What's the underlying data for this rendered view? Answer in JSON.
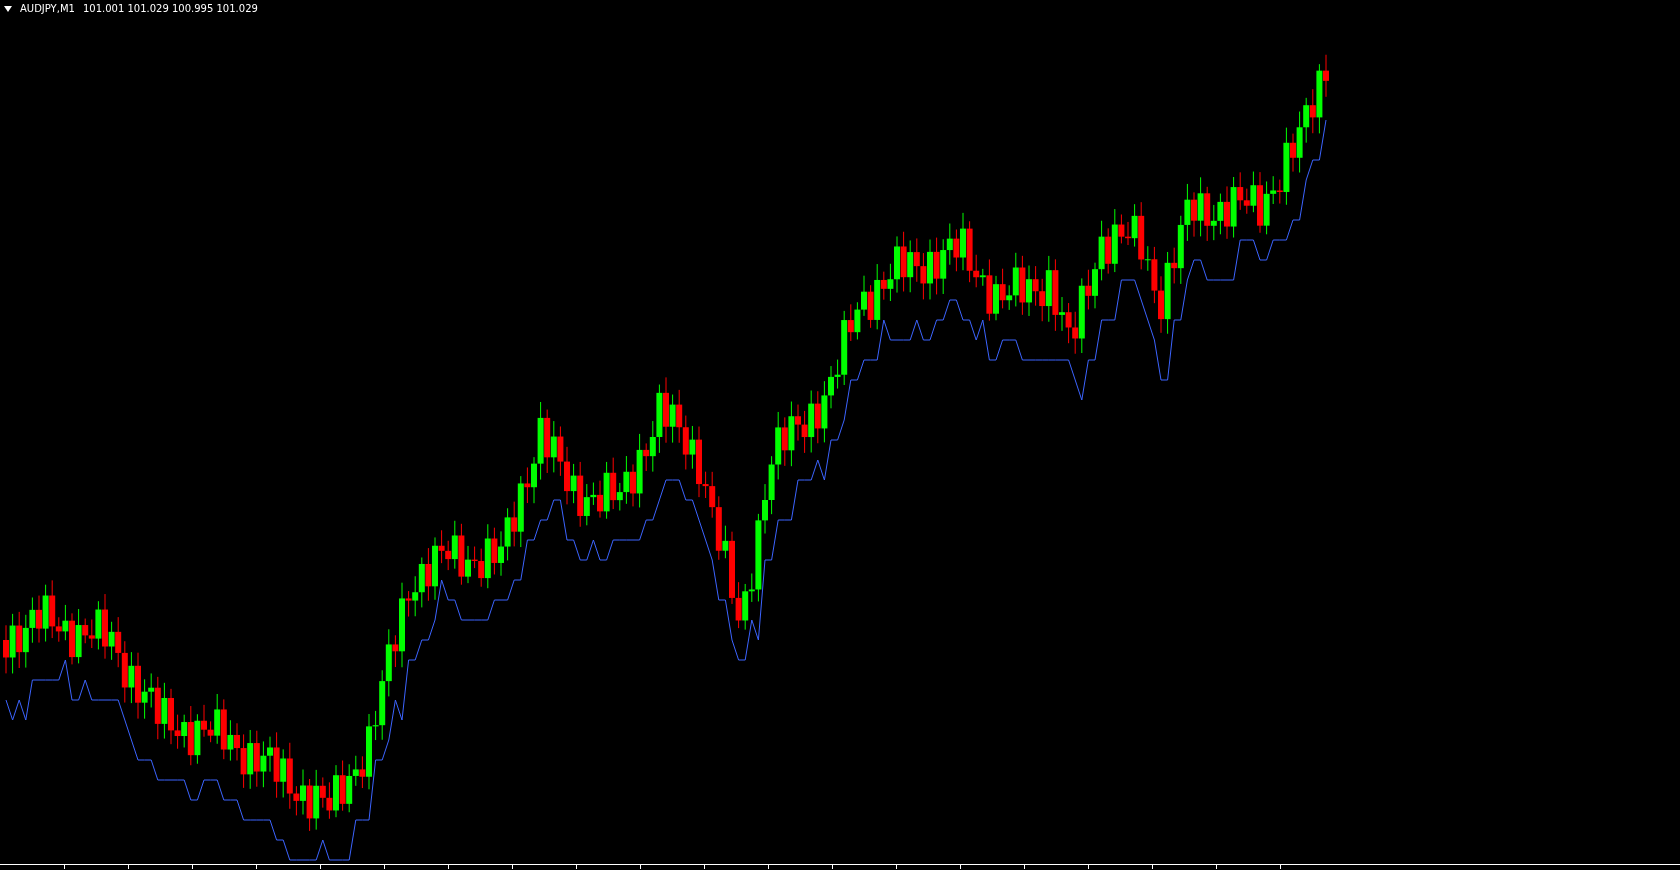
{
  "chart": {
    "symbol": "AUDJPY,M1",
    "quotes": "101.001 101.029 100.995 101.029"
  }
}
